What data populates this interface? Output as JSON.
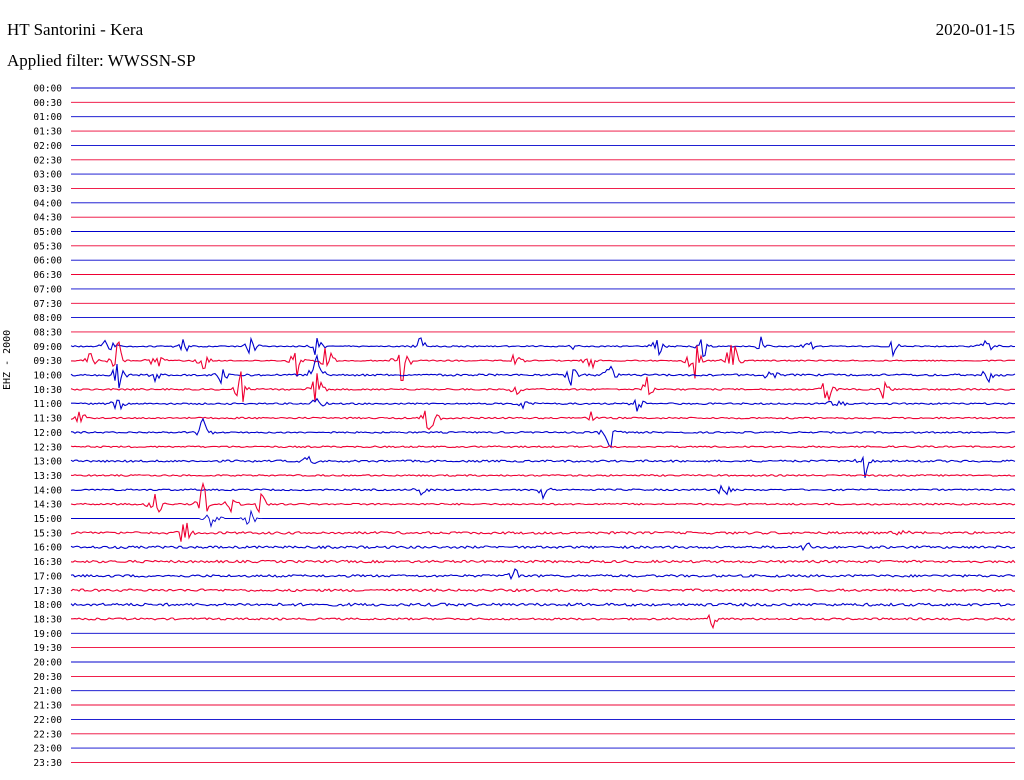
{
  "header": {
    "title": "HT Santorini - Kera",
    "filter": "Applied filter: WWSSN-SP",
    "date": "2020-01-15"
  },
  "chart_data": {
    "type": "line",
    "title": "HT Santorini - Kera",
    "subtitle": "Applied filter: WWSSN-SP",
    "date": "2020-01-15",
    "ylabel": "EHZ - 2000",
    "y_tick_labels": [
      "00:00",
      "00:30",
      "01:00",
      "01:30",
      "02:00",
      "02:30",
      "03:00",
      "03:30",
      "04:00",
      "04:30",
      "05:00",
      "05:30",
      "06:00",
      "06:30",
      "07:00",
      "07:30",
      "08:00",
      "08:30",
      "09:00",
      "09:30",
      "10:00",
      "10:30",
      "11:00",
      "11:30",
      "12:00",
      "12:30",
      "13:00",
      "13:30",
      "14:00",
      "14:30",
      "15:00",
      "15:30",
      "16:00",
      "16:30",
      "17:00",
      "17:30",
      "18:00",
      "18:30",
      "19:00",
      "19:30",
      "20:00",
      "20:30",
      "21:00",
      "21:30",
      "22:00",
      "22:30",
      "23:00",
      "23:30"
    ],
    "colors": {
      "even": "#0000cc",
      "odd": "#ee0033"
    },
    "grid": false,
    "traces": [
      {
        "time": "00:00",
        "noise": 0,
        "events": []
      },
      {
        "time": "00:30",
        "noise": 0,
        "events": []
      },
      {
        "time": "01:00",
        "noise": 0,
        "events": []
      },
      {
        "time": "01:30",
        "noise": 0,
        "events": []
      },
      {
        "time": "02:00",
        "noise": 0,
        "events": []
      },
      {
        "time": "02:30",
        "noise": 0,
        "events": []
      },
      {
        "time": "03:00",
        "noise": 0,
        "events": []
      },
      {
        "time": "03:30",
        "noise": 0,
        "events": []
      },
      {
        "time": "04:00",
        "noise": 0,
        "events": []
      },
      {
        "time": "04:30",
        "noise": 0,
        "events": []
      },
      {
        "time": "05:00",
        "noise": 0,
        "events": []
      },
      {
        "time": "05:30",
        "noise": 0,
        "events": []
      },
      {
        "time": "06:00",
        "noise": 0,
        "events": []
      },
      {
        "time": "06:30",
        "noise": 0,
        "events": []
      },
      {
        "time": "07:00",
        "noise": 0,
        "events": []
      },
      {
        "time": "07:30",
        "noise": 0,
        "events": []
      },
      {
        "time": "08:00",
        "noise": 0,
        "events": []
      },
      {
        "time": "08:30",
        "noise": 0,
        "events": []
      },
      {
        "time": "09:00",
        "noise": 0.6,
        "events": [
          [
            0.04,
            1.6
          ],
          [
            0.12,
            1.0
          ],
          [
            0.19,
            1.3
          ],
          [
            0.26,
            1.6
          ],
          [
            0.37,
            1.2
          ],
          [
            0.53,
            0.8
          ],
          [
            0.62,
            1.4
          ],
          [
            0.67,
            1.6
          ],
          [
            0.73,
            1.2
          ],
          [
            0.78,
            0.9
          ],
          [
            0.87,
            1.0
          ],
          [
            0.97,
            1.2
          ]
        ]
      },
      {
        "time": "09:30",
        "noise": 0.6,
        "events": [
          [
            0.02,
            1.0
          ],
          [
            0.05,
            2.3
          ],
          [
            0.09,
            1.3
          ],
          [
            0.14,
            1.2
          ],
          [
            0.24,
            2.6
          ],
          [
            0.27,
            2.4
          ],
          [
            0.35,
            4.0
          ],
          [
            0.47,
            1.0
          ],
          [
            0.55,
            1.3
          ],
          [
            0.66,
            3.0
          ],
          [
            0.7,
            3.2
          ]
        ]
      },
      {
        "time": "10:00",
        "noise": 1.0,
        "events": [
          [
            0.05,
            2.0
          ],
          [
            0.09,
            1.2
          ],
          [
            0.16,
            1.3
          ],
          [
            0.26,
            3.0
          ],
          [
            0.53,
            1.6
          ],
          [
            0.57,
            1.5
          ],
          [
            0.74,
            1.0
          ],
          [
            0.97,
            1.0
          ]
        ]
      },
      {
        "time": "10:30",
        "noise": 0.8,
        "events": [
          [
            0.18,
            2.0
          ],
          [
            0.26,
            3.1
          ],
          [
            0.47,
            1.0
          ],
          [
            0.61,
            1.4
          ],
          [
            0.8,
            2.0
          ],
          [
            0.86,
            1.0
          ]
        ]
      },
      {
        "time": "11:00",
        "noise": 0.8,
        "events": [
          [
            0.05,
            1.2
          ],
          [
            0.26,
            1.0
          ],
          [
            0.48,
            1.0
          ],
          [
            0.6,
            1.6
          ],
          [
            0.81,
            1.0
          ]
        ]
      },
      {
        "time": "11:30",
        "noise": 0.8,
        "events": [
          [
            0.01,
            1.0
          ],
          [
            0.38,
            2.5
          ],
          [
            0.55,
            0.8
          ]
        ]
      },
      {
        "time": "12:00",
        "noise": 0.8,
        "events": [
          [
            0.14,
            2.0
          ],
          [
            0.57,
            2.2
          ]
        ]
      },
      {
        "time": "12:30",
        "noise": 0.8,
        "events": []
      },
      {
        "time": "13:00",
        "noise": 1.0,
        "events": [
          [
            0.25,
            1.0
          ],
          [
            0.84,
            1.8
          ]
        ]
      },
      {
        "time": "13:30",
        "noise": 0.8,
        "events": []
      },
      {
        "time": "14:00",
        "noise": 0.8,
        "events": [
          [
            0.37,
            1.0
          ],
          [
            0.5,
            1.0
          ],
          [
            0.69,
            1.3
          ]
        ]
      },
      {
        "time": "14:30",
        "noise": 0.8,
        "events": [
          [
            0.09,
            1.8
          ],
          [
            0.14,
            2.5
          ],
          [
            0.17,
            2.6
          ],
          [
            0.2,
            2.2
          ]
        ]
      },
      {
        "time": "15:00",
        "noise": 0,
        "events": [
          [
            0.15,
            2.0
          ],
          [
            0.19,
            1.5
          ]
        ]
      },
      {
        "time": "15:30",
        "noise": 1.2,
        "events": [
          [
            0.12,
            1.8
          ],
          [
            0.88,
            0.7
          ]
        ]
      },
      {
        "time": "16:00",
        "noise": 1.2,
        "events": [
          [
            0.78,
            1.0
          ]
        ]
      },
      {
        "time": "16:30",
        "noise": 1.2,
        "events": []
      },
      {
        "time": "17:00",
        "noise": 1.2,
        "events": [
          [
            0.47,
            1.0
          ]
        ]
      },
      {
        "time": "17:30",
        "noise": 1.2,
        "events": []
      },
      {
        "time": "18:00",
        "noise": 1.4,
        "events": []
      },
      {
        "time": "18:30",
        "noise": 1.0,
        "events": [
          [
            0.68,
            1.0
          ]
        ]
      },
      {
        "time": "19:00",
        "noise": 0,
        "events": []
      },
      {
        "time": "19:30",
        "noise": 0,
        "events": []
      },
      {
        "time": "20:00",
        "noise": 0,
        "events": []
      },
      {
        "time": "20:30",
        "noise": 0,
        "events": []
      },
      {
        "time": "21:00",
        "noise": 0,
        "events": []
      },
      {
        "time": "21:30",
        "noise": 0,
        "events": []
      },
      {
        "time": "22:00",
        "noise": 0,
        "events": []
      },
      {
        "time": "22:30",
        "noise": 0,
        "events": []
      },
      {
        "time": "23:00",
        "noise": 0,
        "events": []
      },
      {
        "time": "23:30",
        "noise": 0,
        "events": []
      }
    ]
  }
}
